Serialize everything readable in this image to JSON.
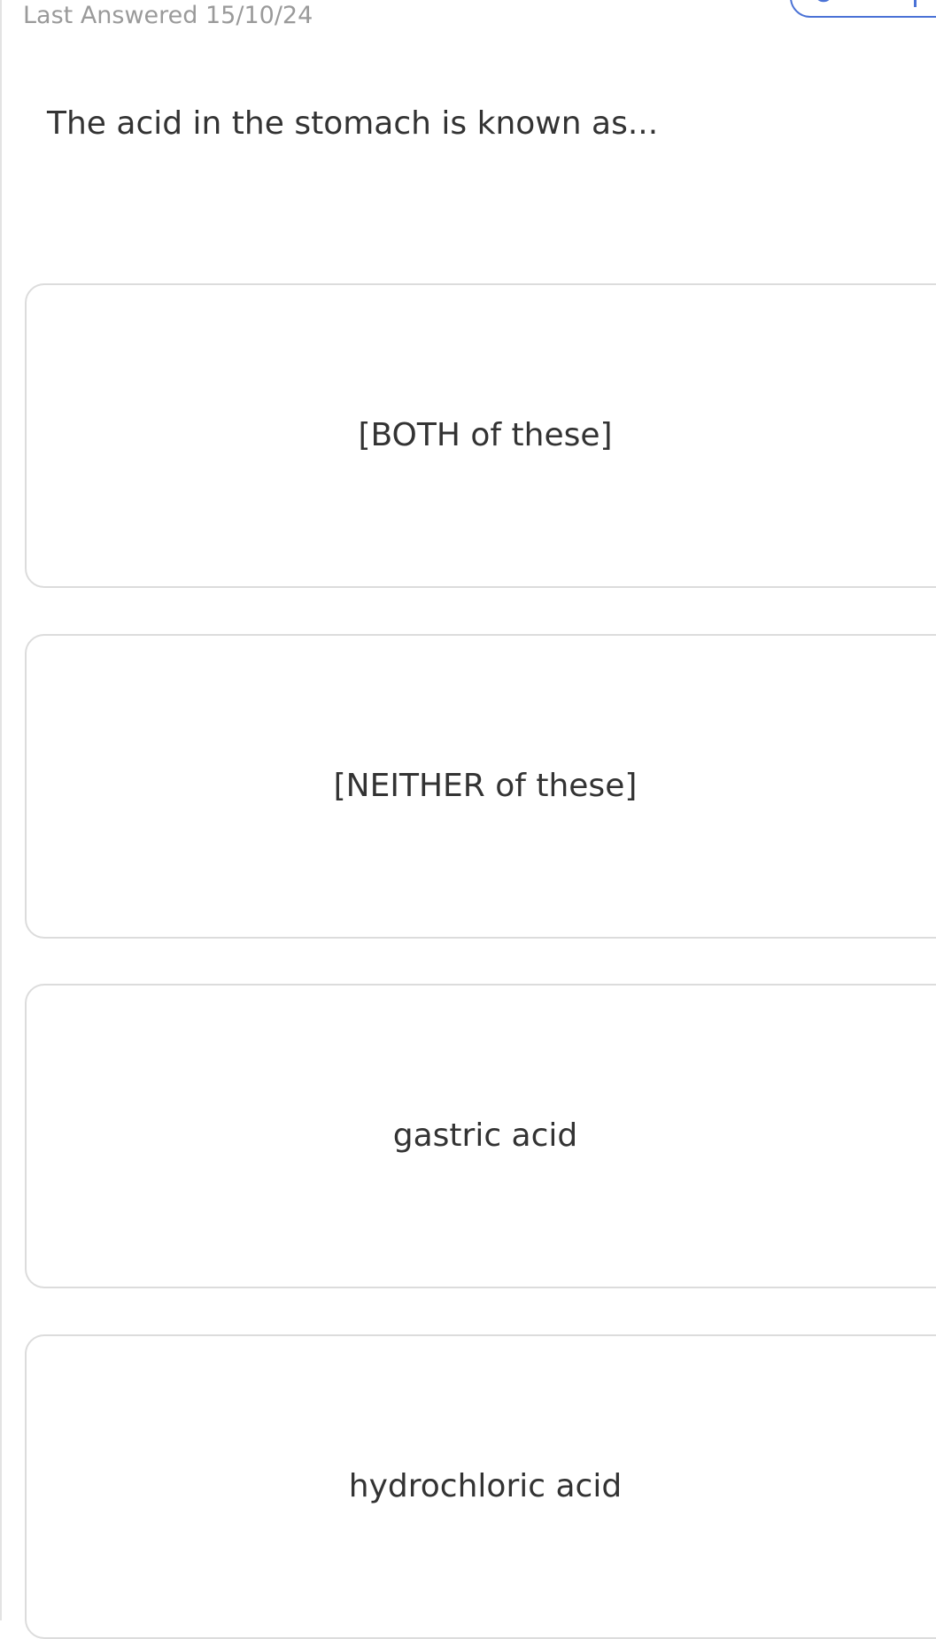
{
  "header": {
    "last_answered": "Last Answered 15/10/24"
  },
  "corner_pill": {
    "icon": "pill-icon",
    "accent_color": "#4a72d6"
  },
  "question": {
    "text": "The acid in the stomach is known as..."
  },
  "options": [
    {
      "label": "[BOTH of these]"
    },
    {
      "label": "[NEITHER of these]"
    },
    {
      "label": "gastric acid"
    },
    {
      "label": "hydrochloric acid"
    }
  ]
}
